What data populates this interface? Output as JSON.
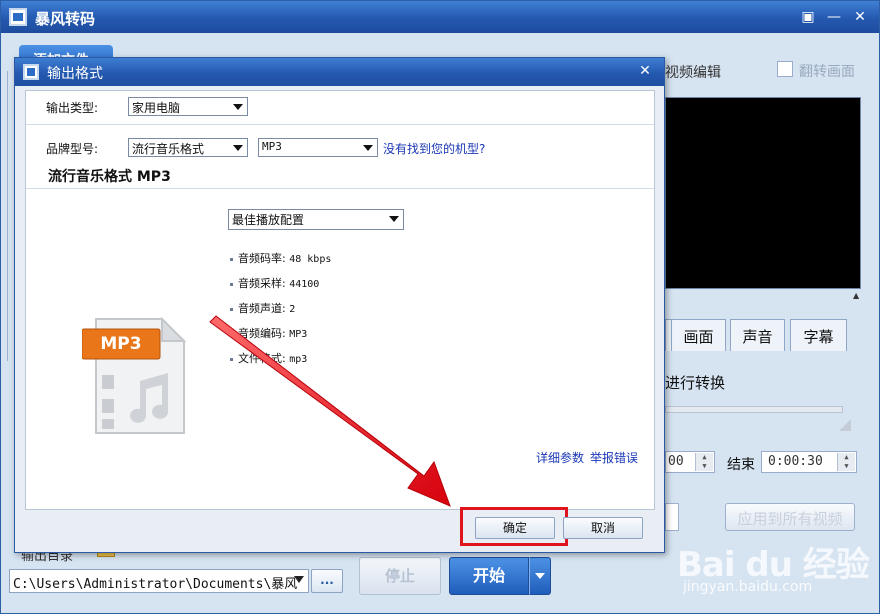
{
  "main": {
    "title": "暴风转码",
    "add_file_tab": "添加文件",
    "video_edit_label": "视频编辑",
    "flip_label": "翻转画面",
    "tabs": [
      {
        "label": "画面"
      },
      {
        "label": "声音"
      },
      {
        "label": "字幕"
      }
    ],
    "convert_label": "进行转换",
    "start_time_value": "00",
    "end_label": "结束",
    "end_time_value": "0:00:30",
    "apply_all_label": "应用到所有视频",
    "output_dir_label": "输出目录",
    "output_path": "C:\\Users\\Administrator\\Documents\\暴风",
    "browse_label": "...",
    "stop_label": "停止",
    "start_label": "开始"
  },
  "dialog": {
    "title": "输出格式",
    "output_type_label": "输出类型:",
    "output_type_value": "家用电脑",
    "brand_label": "品牌型号:",
    "brand_value": "流行音乐格式",
    "model_value": "MP3",
    "model_missing_link": "没有找到您的机型?",
    "section_title": "流行音乐格式 MP3",
    "preset_value": "最佳播放配置",
    "params": [
      {
        "label": "音频码率:",
        "value": "48 kbps"
      },
      {
        "label": "音频采样:",
        "value": "44100"
      },
      {
        "label": "音频声道:",
        "value": "2"
      },
      {
        "label": "音频编码:",
        "value": "MP3"
      },
      {
        "label": "文件格式:",
        "value": "mp3"
      }
    ],
    "file_icon_badge": "MP3",
    "detail_params_link": "详细参数",
    "report_error_link": "举报错误",
    "confirm_label": "确定",
    "cancel_label": "取消"
  },
  "watermark": {
    "logo": "Bai du 经验",
    "url": "jingyan.baidu.com"
  },
  "colors": {
    "titlebar": "#2459b0",
    "accent_blue": "#1f5dbb",
    "highlight_red": "#e0141d",
    "mp3_badge": "#e9771a"
  }
}
